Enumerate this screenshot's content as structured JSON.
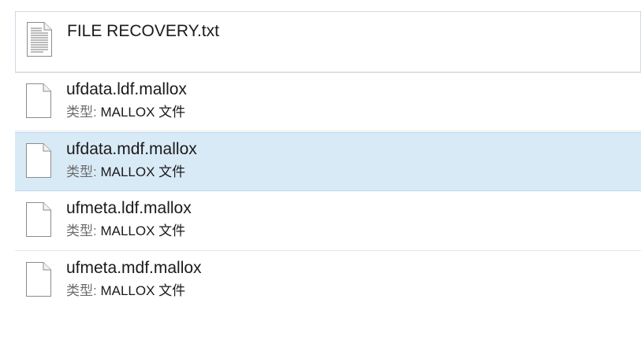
{
  "files": [
    {
      "name": "FILE RECOVERY.txt",
      "icon": "text-document-icon"
    },
    {
      "name": "ufdata.ldf.mallox",
      "type_label": "类型:",
      "type_value": "MALLOX 文件",
      "icon": "blank-file-icon"
    },
    {
      "name": "ufdata.mdf.mallox",
      "type_label": "类型:",
      "type_value": "MALLOX 文件",
      "icon": "blank-file-icon",
      "selected": true
    },
    {
      "name": "ufmeta.ldf.mallox",
      "type_label": "类型:",
      "type_value": "MALLOX 文件",
      "icon": "blank-file-icon"
    },
    {
      "name": "ufmeta.mdf.mallox",
      "type_label": "类型:",
      "type_value": "MALLOX 文件",
      "icon": "blank-file-icon"
    }
  ],
  "colors": {
    "selection_bg": "#d9eaf7",
    "selection_border": "#b9d6ee"
  }
}
